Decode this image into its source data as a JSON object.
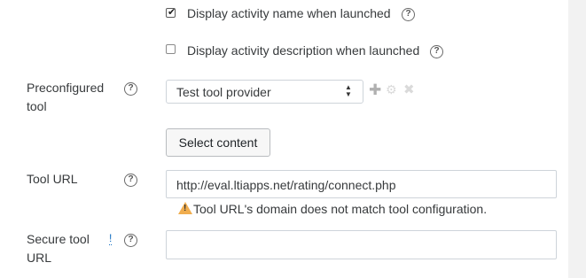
{
  "display_name_checkbox": {
    "label": "Display activity name when launched",
    "checked": true
  },
  "display_description_checkbox": {
    "label": "Display activity description when launched",
    "checked": false
  },
  "preconfigured_tool": {
    "label_line1": "Preconfigured",
    "label_line2": "tool",
    "selected": "Test tool provider",
    "add_icon": "plus-icon",
    "edit_icon": "gear-icon",
    "delete_icon": "x-icon"
  },
  "select_content_button": "Select content",
  "tool_url": {
    "label": "Tool URL",
    "value": "http://eval.ltiapps.net/rating/connect.php",
    "warning": "Tool URL's domain does not match tool configuration."
  },
  "secure_tool_url": {
    "label_line1": "Secure tool",
    "label_line2": "URL",
    "info_marker": "!",
    "value": ""
  },
  "help_icon_glyph": "?",
  "colors": {
    "warning": "#f0ad4e",
    "strip": "#f2f2f2"
  }
}
